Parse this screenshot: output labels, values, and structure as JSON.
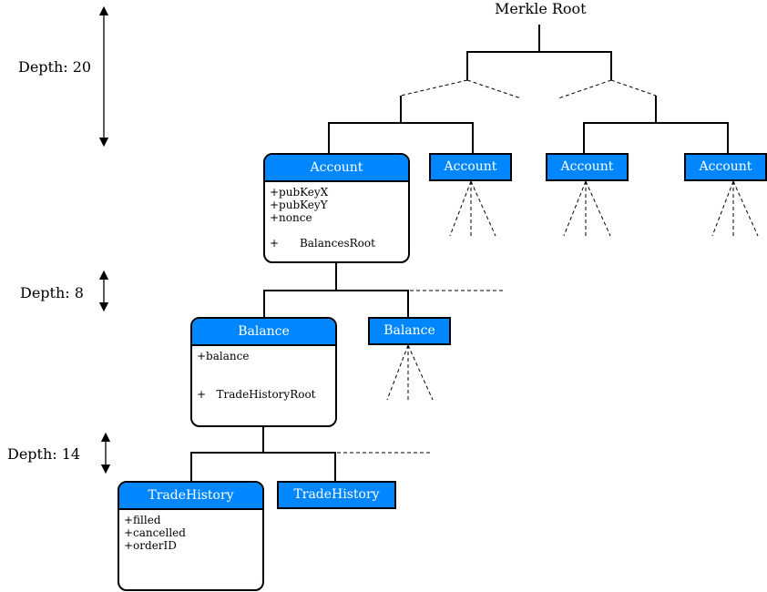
{
  "title": "Merkle Root",
  "depth_labels": [
    "Depth: 20",
    "Depth: 8",
    "Depth: 14"
  ],
  "colors": {
    "node_fill": "#0087ff",
    "node_text": "#ffffff",
    "stroke": "#000000"
  },
  "account_card": {
    "header": "Account",
    "fields": [
      "+pubKeyX",
      "+pubKeyY",
      "+nonce",
      "",
      "+      BalancesRoot"
    ]
  },
  "account_nodes": [
    "Account",
    "Account",
    "Account"
  ],
  "balance_card": {
    "header": "Balance",
    "fields": [
      "+balance",
      "",
      "",
      "+   TradeHistoryRoot"
    ]
  },
  "balance_nodes": [
    "Balance"
  ],
  "tradehistory_card": {
    "header": "TradeHistory",
    "fields": [
      "+filled",
      "+cancelled",
      "+orderID"
    ]
  },
  "tradehistory_nodes": [
    "TradeHistory"
  ]
}
